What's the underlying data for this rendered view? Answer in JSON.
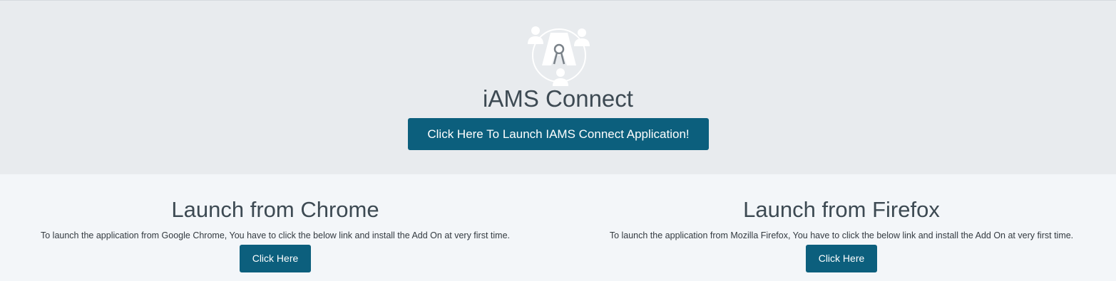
{
  "hero": {
    "logo_icon": "iams-keyhole-people-logo-icon",
    "title": "iAMS Connect",
    "launch_button_label": "Click Here To Launch IAMS Connect Application!"
  },
  "colors": {
    "hero_bg": "#e8ebee",
    "lower_bg": "#f3f6f9",
    "button_bg": "#0c5f7d",
    "heading_text": "#3d4a53"
  },
  "chrome": {
    "heading": "Launch from Chrome",
    "description": "To launch the application from Google Chrome, You have to click the below link and install the Add On at very first time.",
    "button_label": "Click Here"
  },
  "firefox": {
    "heading": "Launch from Firefox",
    "description": "To launch the application from Mozilla Firefox, You have to click the below link and install the Add On at very first time.",
    "button_label": "Click Here"
  }
}
